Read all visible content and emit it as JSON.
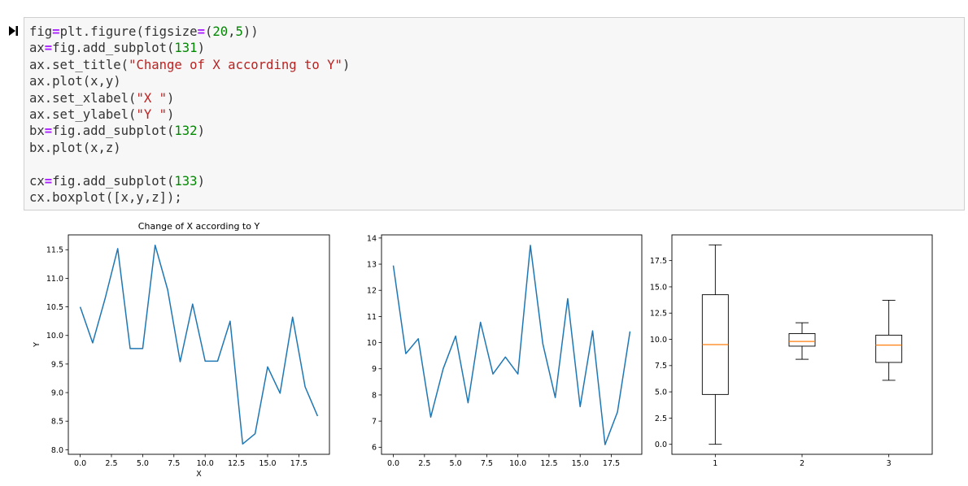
{
  "cell": {
    "code_lines": [
      [
        [
          "fig",
          "id"
        ],
        [
          "=",
          "op"
        ],
        [
          "plt.figure(figsize",
          "id"
        ],
        [
          "=",
          "op"
        ],
        [
          "(",
          "id"
        ],
        [
          "20",
          "num"
        ],
        [
          ",",
          "id"
        ],
        [
          "5",
          "num"
        ],
        [
          "))",
          "id"
        ]
      ],
      [
        [
          "ax",
          "id"
        ],
        [
          "=",
          "op"
        ],
        [
          "fig.add_subplot(",
          "id"
        ],
        [
          "131",
          "num"
        ],
        [
          ")",
          "id"
        ]
      ],
      [
        [
          "ax.set_title(",
          "id"
        ],
        [
          "\"Change of X according to Y\"",
          "str"
        ],
        [
          ")",
          "id"
        ]
      ],
      [
        [
          "ax.plot(x,y)",
          "id"
        ]
      ],
      [
        [
          "ax.set_xlabel(",
          "id"
        ],
        [
          "\"X \"",
          "str"
        ],
        [
          ")",
          "id"
        ]
      ],
      [
        [
          "ax.set_ylabel(",
          "id"
        ],
        [
          "\"Y \"",
          "str"
        ],
        [
          ")",
          "id"
        ]
      ],
      [
        [
          "bx",
          "id"
        ],
        [
          "=",
          "op"
        ],
        [
          "fig.add_subplot(",
          "id"
        ],
        [
          "132",
          "num"
        ],
        [
          ")",
          "id"
        ]
      ],
      [
        [
          "bx.plot(x,z)",
          "id"
        ]
      ],
      [],
      [
        [
          "cx",
          "id"
        ],
        [
          "=",
          "op"
        ],
        [
          "fig.add_subplot(",
          "id"
        ],
        [
          "133",
          "num"
        ],
        [
          ")",
          "id"
        ]
      ],
      [
        [
          "cx.boxplot([x,y,z]);",
          "id"
        ]
      ]
    ]
  },
  "colors": {
    "line": "#1f77b4",
    "median": "#ff7f0e",
    "axis": "#000000"
  },
  "icons": {
    "run": "step-forward-icon"
  },
  "chart_data": [
    {
      "type": "line",
      "title": "Change of X according to Y",
      "xlabel": "X",
      "ylabel": "Y",
      "xlim": [
        -0.95,
        19.95
      ],
      "ylim": [
        7.92,
        11.76
      ],
      "xticks": [
        0.0,
        2.5,
        5.0,
        7.5,
        10.0,
        12.5,
        15.0,
        17.5
      ],
      "xtick_labels": [
        "0.0",
        "2.5",
        "5.0",
        "7.5",
        "10.0",
        "12.5",
        "15.0",
        "17.5"
      ],
      "yticks": [
        8.0,
        8.5,
        9.0,
        9.5,
        10.0,
        10.5,
        11.0,
        11.5
      ],
      "ytick_labels": [
        "8.0",
        "8.5",
        "9.0",
        "9.5",
        "10.0",
        "10.5",
        "11.0",
        "11.5"
      ],
      "x": [
        0,
        1,
        2,
        3,
        4,
        5,
        6,
        7,
        8,
        9,
        10,
        11,
        12,
        13,
        14,
        15,
        16,
        17,
        18,
        19
      ],
      "y": [
        10.5,
        9.87,
        10.65,
        11.52,
        9.77,
        9.77,
        11.58,
        10.8,
        9.54,
        10.55,
        9.55,
        9.55,
        10.25,
        8.1,
        8.28,
        9.45,
        8.99,
        10.32,
        9.1,
        8.59
      ]
    },
    {
      "type": "line",
      "title": "",
      "xlabel": "",
      "ylabel": "",
      "xlim": [
        -0.95,
        19.95
      ],
      "ylim": [
        5.73,
        14.12
      ],
      "xticks": [
        0.0,
        2.5,
        5.0,
        7.5,
        10.0,
        12.5,
        15.0,
        17.5
      ],
      "xtick_labels": [
        "0.0",
        "2.5",
        "5.0",
        "7.5",
        "10.0",
        "12.5",
        "15.0",
        "17.5"
      ],
      "yticks": [
        6,
        7,
        8,
        9,
        10,
        11,
        12,
        13,
        14
      ],
      "ytick_labels": [
        "6",
        "7",
        "8",
        "9",
        "10",
        "11",
        "12",
        "13",
        "14"
      ],
      "x": [
        0,
        1,
        2,
        3,
        4,
        5,
        6,
        7,
        8,
        9,
        10,
        11,
        12,
        13,
        14,
        15,
        16,
        17,
        18,
        19
      ],
      "y": [
        12.95,
        9.58,
        10.15,
        7.15,
        9.0,
        10.25,
        7.7,
        10.78,
        8.8,
        9.45,
        8.8,
        13.72,
        9.96,
        7.9,
        11.68,
        7.55,
        10.45,
        6.1,
        7.35,
        10.43
      ]
    },
    {
      "type": "box",
      "title": "",
      "xlabel": "",
      "ylabel": "",
      "xlim": [
        0.5,
        3.5
      ],
      "ylim": [
        -0.95,
        19.95
      ],
      "xticks": [
        1,
        2,
        3
      ],
      "xtick_labels": [
        "1",
        "2",
        "3"
      ],
      "yticks": [
        0.0,
        2.5,
        5.0,
        7.5,
        10.0,
        12.5,
        15.0,
        17.5
      ],
      "ytick_labels": [
        "0.0",
        "2.5",
        "5.0",
        "7.5",
        "10.0",
        "12.5",
        "15.0",
        "17.5"
      ],
      "boxes": [
        {
          "position": 1,
          "whislo": 0.0,
          "q1": 4.75,
          "med": 9.5,
          "q3": 14.25,
          "whishi": 19.0
        },
        {
          "position": 2,
          "whislo": 8.1,
          "q1": 9.35,
          "med": 9.8,
          "q3": 10.55,
          "whishi": 11.58
        },
        {
          "position": 3,
          "whislo": 6.1,
          "q1": 7.8,
          "med": 9.45,
          "q3": 10.4,
          "whishi": 13.72
        }
      ]
    }
  ]
}
